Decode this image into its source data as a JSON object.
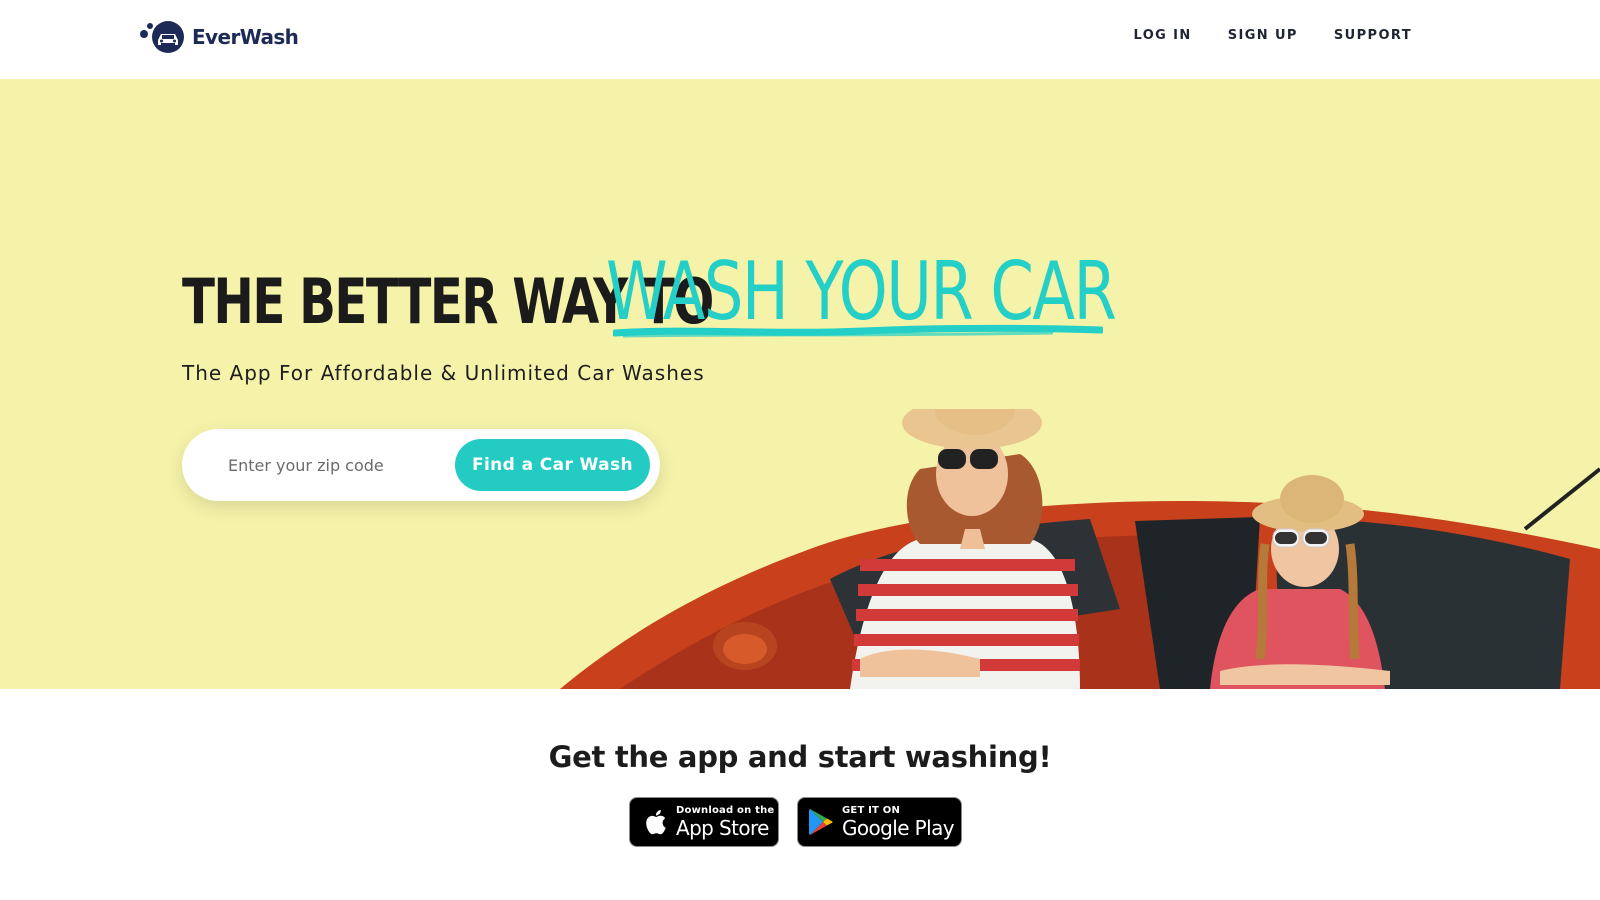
{
  "brand": {
    "name": "EverWash",
    "logo_icon": "car-bubbles-icon",
    "color": "#1d2a55"
  },
  "nav": {
    "items": [
      "LOG IN",
      "SIGN UP",
      "SUPPORT"
    ]
  },
  "hero": {
    "headline_dark": "THE BETTER WAY TO",
    "headline_accent": "WASH YOUR CAR",
    "subheadline": "The App For Affordable & Unlimited Car Washes",
    "zip_placeholder": "Enter your zip code",
    "cta_label": "Find a Car Wash",
    "image": "woman-and-girl-in-red-car-photo",
    "colors": {
      "background": "#f5f3a9",
      "accent": "#23cfc6"
    }
  },
  "app_section": {
    "title": "Get the app and start washing!",
    "app_store": {
      "small_text": "Download on the",
      "big_text": "App Store",
      "icon": "apple-icon"
    },
    "google_play": {
      "small_text": "GET IT ON",
      "big_text": "Google Play",
      "icon": "google-play-icon"
    }
  }
}
